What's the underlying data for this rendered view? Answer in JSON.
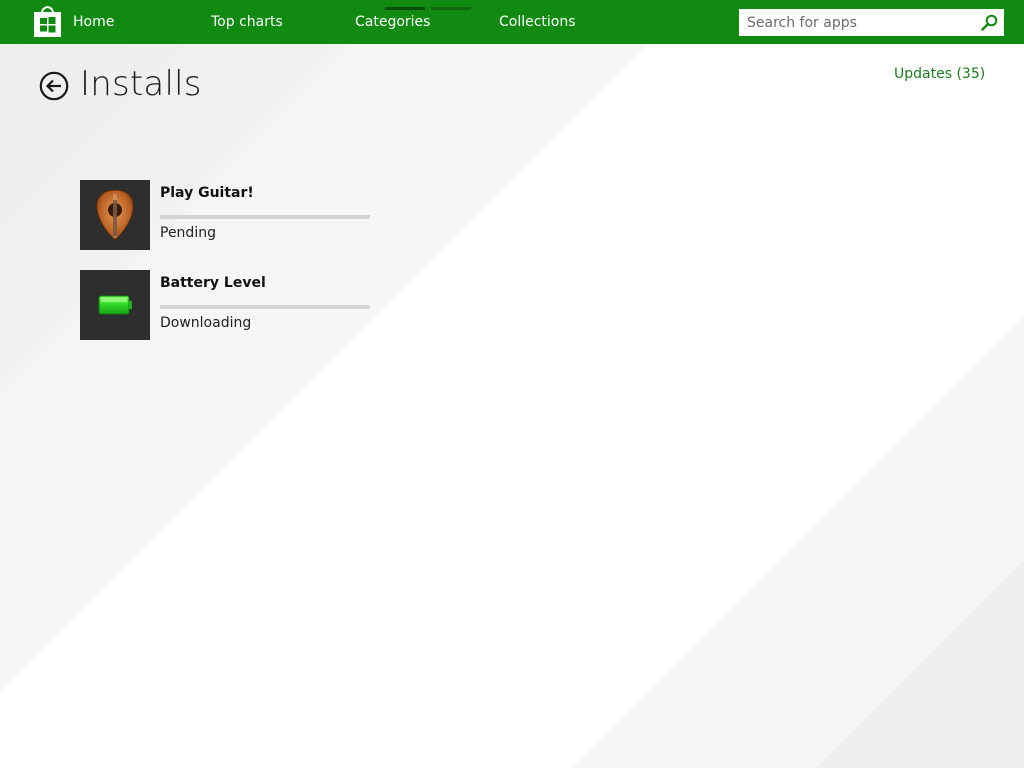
{
  "nav": {
    "logo_icon": "store-bag-icon",
    "items": [
      {
        "label": "Home"
      },
      {
        "label": "Top charts"
      },
      {
        "label": "Categories"
      },
      {
        "label": "Collections"
      }
    ]
  },
  "search": {
    "placeholder": "Search for apps",
    "value": "",
    "icon": "search-icon"
  },
  "page": {
    "title": "Installs",
    "back_icon": "back-arrow-icon",
    "updates_label": "Updates (35)"
  },
  "installs": [
    {
      "name": "Play Guitar!",
      "status": "Pending",
      "progress": 0,
      "icon": "guitar-icon"
    },
    {
      "name": "Battery Level",
      "status": "Downloading",
      "progress": 0,
      "icon": "battery-icon"
    }
  ],
  "colors": {
    "accent": "#118a11",
    "link": "#1e7a1e",
    "tile_bg": "#2e2e2e"
  }
}
